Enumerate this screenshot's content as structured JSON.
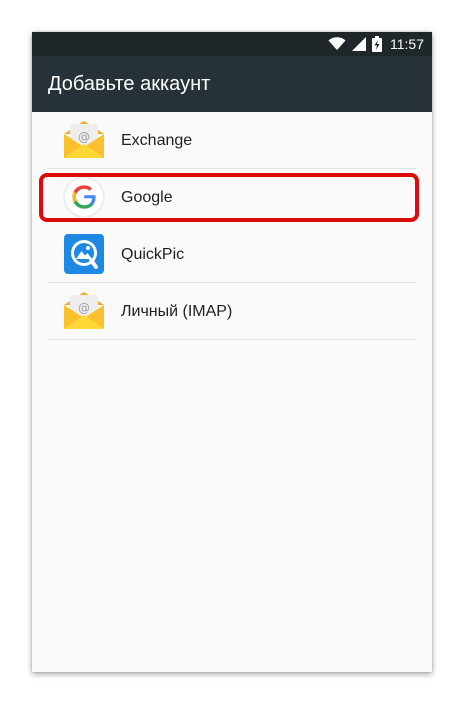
{
  "status_bar": {
    "time": "11:57",
    "icons": [
      "wifi-icon",
      "signal-icon",
      "battery-charging-icon"
    ]
  },
  "app_bar": {
    "title": "Добавьте аккаунт"
  },
  "accounts": [
    {
      "label": "Exchange",
      "icon": "email-envelope-icon"
    },
    {
      "label": "Google",
      "icon": "google-logo-icon",
      "highlighted": true
    },
    {
      "label": "QuickPic",
      "icon": "quickpic-icon"
    },
    {
      "label": "Личный (IMAP)",
      "icon": "email-envelope-icon"
    }
  ],
  "colors": {
    "status_bar": "#1f272b",
    "app_bar": "#263238",
    "background": "#fafafa",
    "highlight": "#dd0a0a",
    "envelope": "#fbc02d",
    "quickpic": "#1e88e5"
  }
}
